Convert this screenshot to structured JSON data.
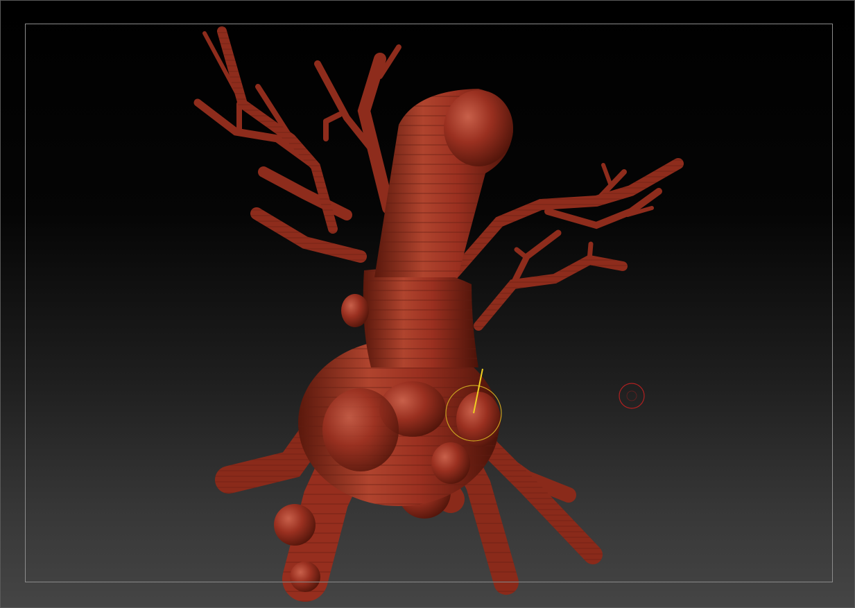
{
  "canvas": {
    "background_top": "#000000",
    "background_bottom": "#454545",
    "document_frame_color": "#8c8c8c"
  },
  "model": {
    "material_color": "#9a3020",
    "highlight_color": "#c8604a",
    "shadow_color": "#4a1208",
    "band_color": "#6e2418"
  },
  "brush": {
    "icon": "brush-cursor-icon",
    "ring_color": "#c8a020",
    "stroke_color": "#f0d020"
  },
  "focal_shift": {
    "icon": "target-reticle-icon",
    "ring_color": "#b02020"
  }
}
